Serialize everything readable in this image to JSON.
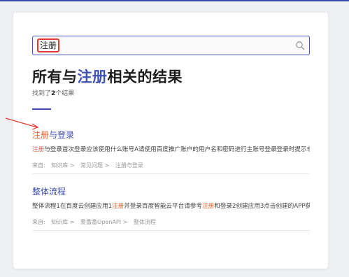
{
  "search": {
    "value": "注册",
    "icon": "search-icon"
  },
  "heading": {
    "prefix": "所有与",
    "keyword": "注册",
    "suffix": "相关的结果"
  },
  "result_count": {
    "prefix": "找到了",
    "count": "2",
    "suffix": "个结果"
  },
  "colors": {
    "accent": "#3f50b5",
    "highlight": "#e8632a",
    "annotation_red": "#e23b2e"
  },
  "results": [
    {
      "title_highlight": "注册",
      "title_rest": "与登录",
      "snippet_highlight": "注册",
      "snippet_rest": "与登录首次登录应该使用什么账号A请使用百度推广账户的用户名和密码进行主账号登录登录时提示非爱...",
      "source_label": "来自:",
      "breadcrumb": [
        "知识库 >",
        "常见问题 >",
        "注册与登录"
      ]
    },
    {
      "title": "整体流程",
      "snippet_before": "整体流程1在百度云创建应用1",
      "snippet_hl1": "注册",
      "snippet_mid": "并登录百度智能云平台请参考",
      "snippet_hl2": "注册",
      "snippet_after": "和登录2创建应用3点击创建的APP获取app...",
      "source_label": "来自:",
      "breadcrumb": [
        "知识库 >",
        "爱番番OpenAPI >",
        "整体流程"
      ]
    }
  ]
}
